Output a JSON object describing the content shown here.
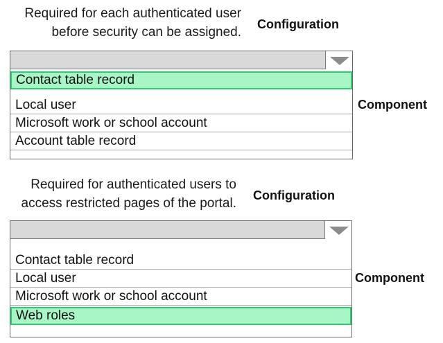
{
  "questions": [
    {
      "requirement_lines": [
        "Required for each authenticated user",
        "before security can be assigned."
      ],
      "configuration_label": "Configuration",
      "component_label": "Component",
      "dropdown": {
        "selected_value": "",
        "options": [
          "Contact table record",
          "Local user",
          "Microsoft work or school account",
          "Account table record"
        ],
        "highlighted_option": "Contact table record"
      }
    },
    {
      "requirement_lines": [
        "Required for authenticated users to",
        "access restricted pages of the portal."
      ],
      "configuration_label": "Configuration",
      "component_label": "Component",
      "dropdown": {
        "selected_value": "",
        "options": [
          "Contact table record",
          "Local user",
          "Microsoft work or school account",
          "Web roles"
        ],
        "highlighted_option": "Web roles"
      }
    }
  ],
  "colors": {
    "highlight_fill": "#a8f5c6",
    "highlight_border": "#2ecc71",
    "dropdown_header": "#d9d9d9"
  }
}
